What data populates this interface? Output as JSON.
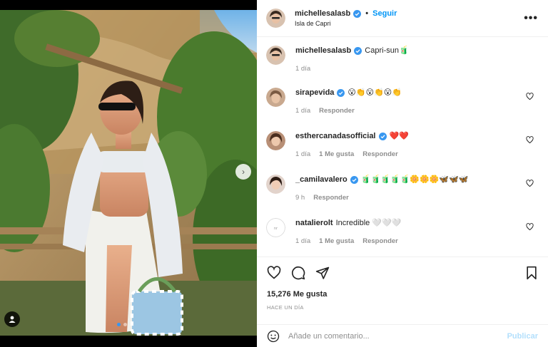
{
  "post": {
    "author": "michellesalasb",
    "location": "Isla de Capri",
    "follow_label": "Seguir",
    "separator": "•",
    "more_glyph": "•••",
    "caption": {
      "username": "michellesalasb",
      "text": "Capri-sun🧃",
      "time": "1 día"
    },
    "carousel": {
      "slides": 2,
      "current": 1
    }
  },
  "comments": [
    {
      "username": "sirapevida",
      "verified": true,
      "text": "😮👏😮👏😮👏",
      "time": "1 día",
      "likes": "",
      "reply": "Responder"
    },
    {
      "username": "esthercanadasofficial",
      "verified": true,
      "text": "❤️❤️",
      "time": "1 día",
      "likes": "1 Me gusta",
      "reply": "Responder"
    },
    {
      "username": "_camilavalero",
      "verified": true,
      "text": "🧃🧃🧃🧃🧃🌼🌼🌼🦋🦋🦋",
      "time": "9 h",
      "likes": "",
      "reply": "Responder"
    },
    {
      "username": "natalierolt",
      "verified": false,
      "text": "Incredible 🤍🤍🤍",
      "time": "1 día",
      "likes": "1 Me gusta",
      "reply": "Responder"
    }
  ],
  "actions": {
    "likes": "15,276 Me gusta",
    "posted_ago": "HACE UN DÍA"
  },
  "composer": {
    "placeholder": "Añade un comentario...",
    "publish_label": "Publicar"
  },
  "colors": {
    "accent": "#0095f6",
    "verified": "#3897f0",
    "muted": "#8e8e8e",
    "publish_disabled": "#b2dffc"
  },
  "icons": [
    "verified-badge-icon",
    "more-options-icon",
    "heart-icon",
    "comment-icon",
    "share-icon",
    "bookmark-icon",
    "emoji-icon",
    "next-arrow-icon",
    "user-tag-icon"
  ]
}
